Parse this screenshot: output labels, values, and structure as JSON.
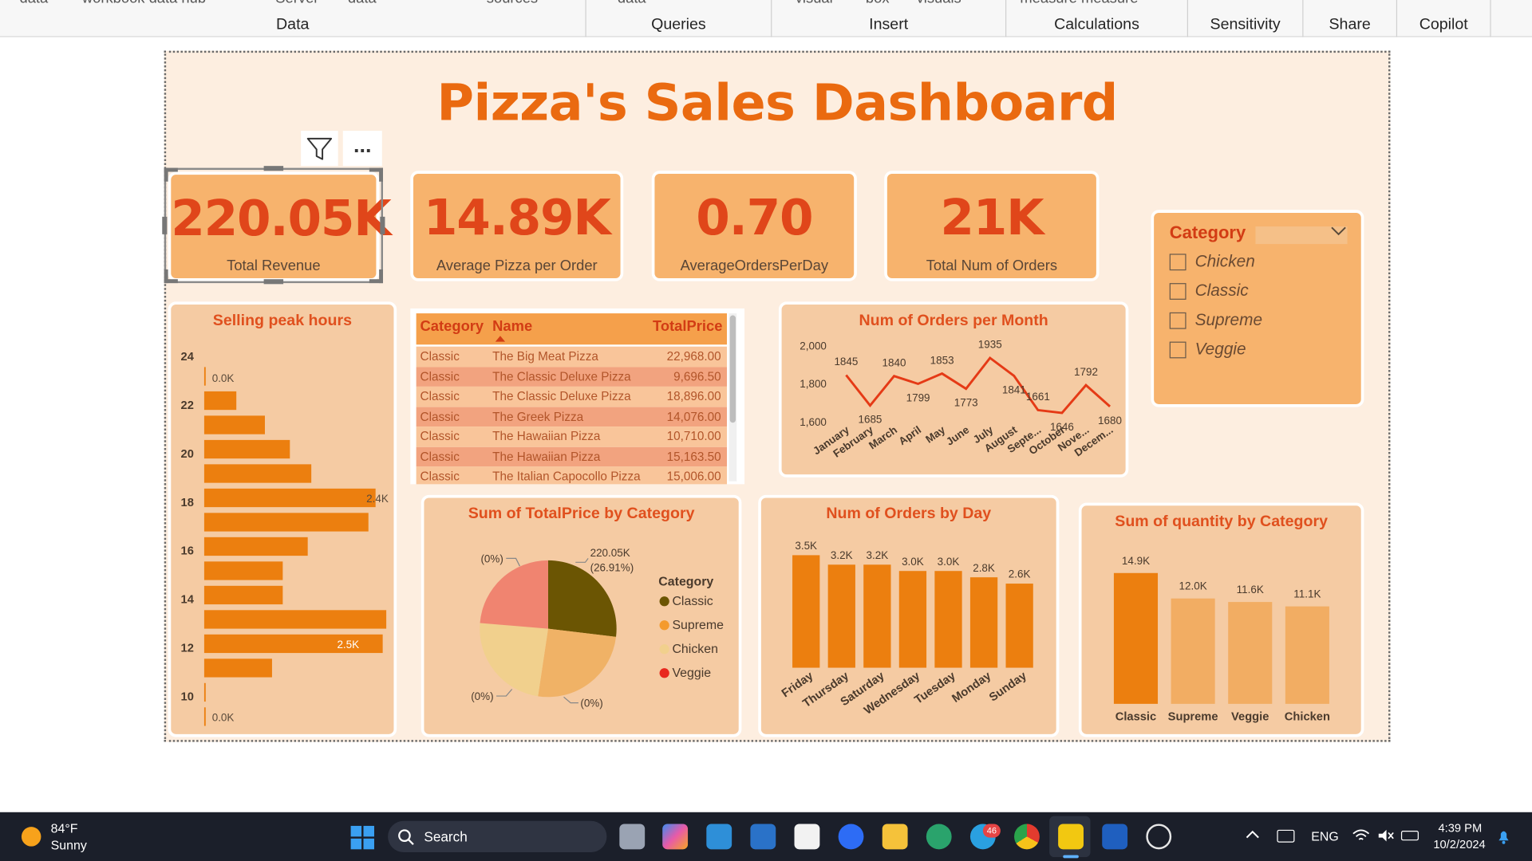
{
  "ribbon": {
    "groups": [
      "Data",
      "Queries",
      "Insert",
      "Calculations",
      "Sensitivity",
      "Share",
      "Copilot"
    ],
    "cut_labels": [
      "data",
      "workbook data hub",
      "Server",
      "data",
      "sources",
      "data",
      "visual",
      "box",
      "visuals",
      "measure measure"
    ]
  },
  "dashboard": {
    "title": "Pizza's Sales Dashboard"
  },
  "visual_header": {
    "filter_icon": "filter-icon",
    "more_icon": "more-options-icon",
    "more_text": "..."
  },
  "kpis": [
    {
      "value": "220.05K",
      "label": "Total Revenue"
    },
    {
      "value": "14.89K",
      "label": "Average Pizza per Order"
    },
    {
      "value": "0.70",
      "label": "AverageOrdersPerDay"
    },
    {
      "value": "21K",
      "label": "Total Num of Orders"
    }
  ],
  "slicer": {
    "title": "Category",
    "items": [
      "Chicken",
      "Classic",
      "Supreme",
      "Veggie"
    ]
  },
  "table": {
    "headers": [
      "Category",
      "Name",
      "TotalPrice"
    ],
    "rows": [
      [
        "Classic",
        "The Big Meat Pizza",
        "22,968.00"
      ],
      [
        "Classic",
        "The Classic Deluxe Pizza",
        "9,696.50"
      ],
      [
        "Classic",
        "The Classic Deluxe Pizza",
        "18,896.00"
      ],
      [
        "Classic",
        "The Greek Pizza",
        "14,076.00"
      ],
      [
        "Classic",
        "The Hawaiian Pizza",
        "10,710.00"
      ],
      [
        "Classic",
        "The Hawaiian Pizza",
        "15,163.50"
      ],
      [
        "Classic",
        "The Italian Capocollo Pizza",
        "15,006.00"
      ]
    ]
  },
  "chart_data": [
    {
      "type": "bar",
      "orientation": "horizontal",
      "title": "Selling peak hours",
      "categories": [
        23,
        22,
        21,
        20,
        19,
        18,
        17,
        16,
        15,
        14,
        13,
        12,
        11,
        10,
        9
      ],
      "values": [
        0,
        0.45,
        0.85,
        1.2,
        1.5,
        2.4,
        2.3,
        1.45,
        1.1,
        1.1,
        2.55,
        2.5,
        0.95,
        0,
        0
      ],
      "tick_labels": [
        "24",
        "22",
        "20",
        "18",
        "16",
        "14",
        "12",
        "10"
      ],
      "data_labels": [
        "0.0K",
        "2.4K",
        "2.5K",
        "0.0K"
      ],
      "xlim": [
        0,
        2.6
      ]
    },
    {
      "type": "line",
      "title": "Num of Orders per Month",
      "categories": [
        "January",
        "February",
        "March",
        "April",
        "May",
        "June",
        "July",
        "August",
        "Septe...",
        "October",
        "Nove...",
        "Decem..."
      ],
      "values": [
        1845,
        1685,
        1840,
        1799,
        1853,
        1773,
        1935,
        1841,
        1661,
        1646,
        1792,
        1680
      ],
      "y_ticks": [
        "2,000",
        "1,800",
        "1,600"
      ],
      "ylim": [
        1600,
        2000
      ]
    },
    {
      "type": "pie",
      "title": "Sum of TotalPrice by Category",
      "legend_title": "Category",
      "series": [
        {
          "name": "Classic",
          "value": 26.91,
          "color": "#6b5503",
          "label": "220.05K (26.91%)"
        },
        {
          "name": "Supreme",
          "value": 25.46,
          "color": "#f0b266",
          "label": "(0%)"
        },
        {
          "name": "Chicken",
          "value": 23.96,
          "color": "#f1d08d",
          "label": "(0%)"
        },
        {
          "name": "Veggie",
          "value": 23.68,
          "color": "#f08470",
          "label": "(0%)"
        }
      ],
      "legend_colors": [
        "#6b5503",
        "#f49a2c",
        "#f1d08d",
        "#e8281e"
      ]
    },
    {
      "type": "bar",
      "title": "Num of Orders by Day",
      "categories": [
        "Friday",
        "Thursday",
        "Saturday",
        "Wednesday",
        "Tuesday",
        "Monday",
        "Sunday"
      ],
      "values": [
        3.5,
        3.2,
        3.2,
        3.0,
        3.0,
        2.8,
        2.6
      ],
      "data_labels": [
        "3.5K",
        "3.2K",
        "3.2K",
        "3.0K",
        "3.0K",
        "2.8K",
        "2.6K"
      ]
    },
    {
      "type": "bar",
      "title": "Sum of quantity by Category",
      "categories": [
        "Classic",
        "Supreme",
        "Veggie",
        "Chicken"
      ],
      "values": [
        14.9,
        12.0,
        11.6,
        11.1
      ],
      "data_labels": [
        "14.9K",
        "12.0K",
        "11.6K",
        "11.1K"
      ]
    }
  ],
  "taskbar": {
    "weather_temp": "84°F",
    "weather_desc": "Sunny",
    "search_placeholder": "Search",
    "lang": "ENG",
    "time": "4:39 PM",
    "date": "10/2/2024",
    "telegram_badge": "46"
  },
  "colors": {
    "accent": "#ea6a10",
    "bar": "#ec7f0f",
    "bar_light": "#f2ad63",
    "panel": "#f5cba3",
    "kpi": "#f7b36d",
    "canvas": "#fdeee0"
  }
}
